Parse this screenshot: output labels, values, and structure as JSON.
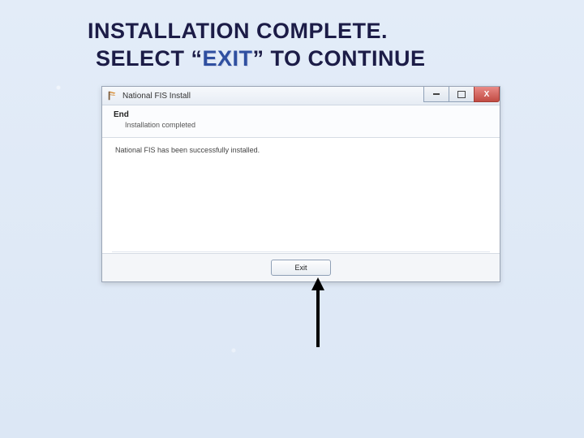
{
  "headline": {
    "line1": "INSTALLATION COMPLETE.",
    "line2_pre": "SELECT “",
    "line2_word": "EXIT",
    "line2_post": "” TO CONTINUE"
  },
  "window": {
    "title": "National FIS Install",
    "section_title": "End",
    "section_subtitle": "Installation completed",
    "body_message": "National FIS has been successfully installed.",
    "buttons": {
      "minimize_glyph": "–",
      "maximize_glyph": "",
      "close_glyph": "X",
      "exit_label": "Exit"
    }
  }
}
